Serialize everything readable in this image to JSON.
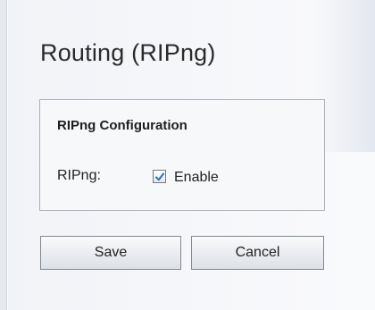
{
  "page": {
    "title": "Routing (RIPng)"
  },
  "config": {
    "section_title": "RIPng Configuration",
    "ripng_label": "RIPng:",
    "enable_label": "Enable",
    "enable_checked": true
  },
  "buttons": {
    "save_label": "Save",
    "cancel_label": "Cancel"
  },
  "colors": {
    "panel_bg": "#f1f3f8",
    "box_border": "#a9b0bb",
    "check_mark": "#2f6db5"
  }
}
